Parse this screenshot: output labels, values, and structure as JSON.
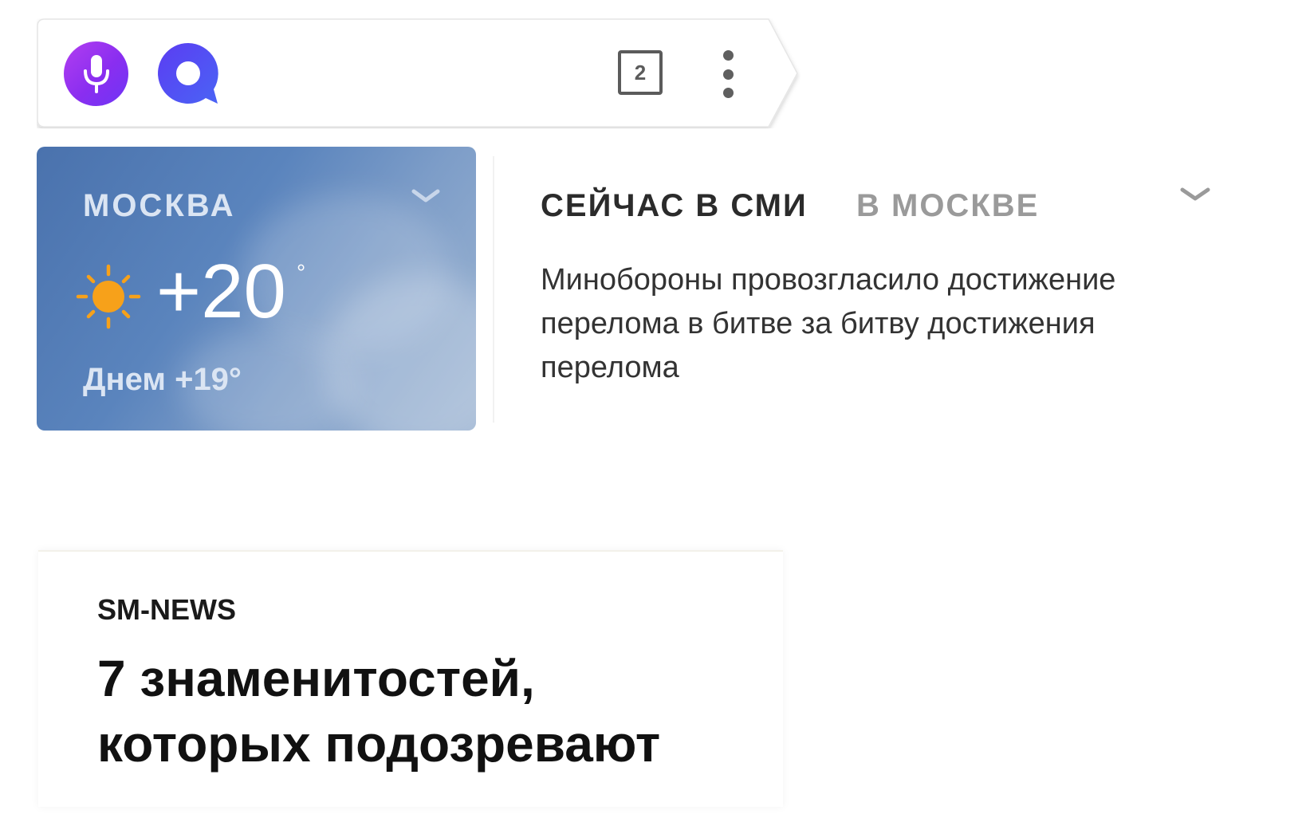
{
  "toolbar": {
    "tabs_count": "2"
  },
  "weather": {
    "city": "МОСКВА",
    "temperature": "+20",
    "degree_symbol": "°",
    "day_forecast": "Днем +19°",
    "condition_icon": "sun-icon"
  },
  "news": {
    "tabs": [
      {
        "label": "СЕЙЧАС В СМИ",
        "active": true
      },
      {
        "label": "В МОСКВЕ",
        "active": false
      }
    ],
    "headline": "Минобороны провозгласило достижение перелома в битве за битву достижения перелома"
  },
  "feed": {
    "source": "SM-NEWS",
    "title": "7 знаменитостей, которых подозревают"
  },
  "colors": {
    "mic_gradient_start": "#b23ef0",
    "mic_gradient_end": "#6e35f5",
    "alice_blue": "#5a4bf0",
    "weather_bg": "#5a84bd",
    "sun": "#f7a11a"
  }
}
